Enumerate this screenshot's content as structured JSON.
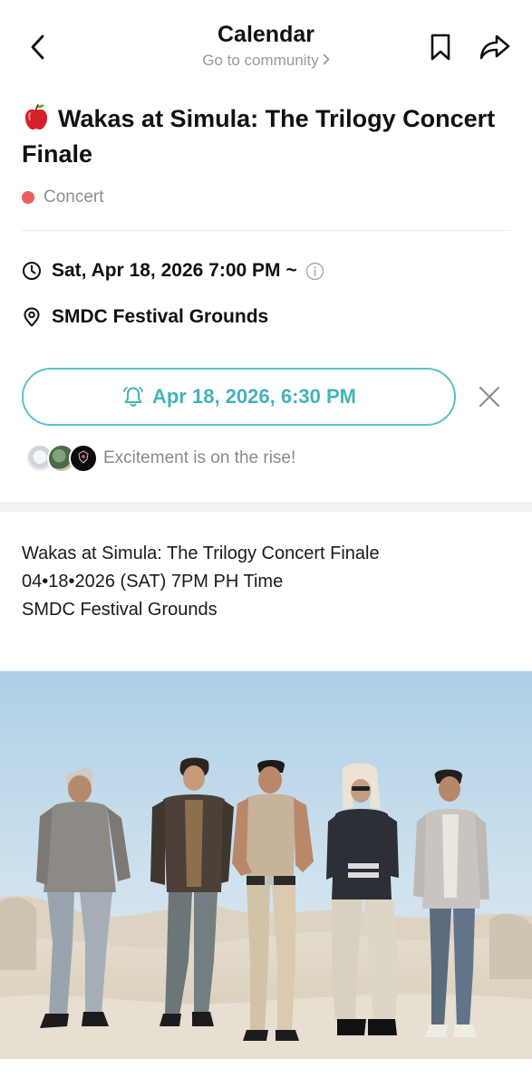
{
  "header": {
    "title": "Calendar",
    "subtitle": "Go to community",
    "icons": {
      "back": "chevron-left-icon",
      "bookmark": "bookmark-icon",
      "share": "share-arrow-icon"
    }
  },
  "event": {
    "emoji": "apple-emoji",
    "title": "Wakas at Simula: The Trilogy Concert Finale",
    "category": "Concert",
    "category_color": "#ee5d5d",
    "datetime": "Sat, Apr 18, 2026 7:00 PM ~",
    "location": "SMDC Festival Grounds"
  },
  "reminder": {
    "label": "Apr 18, 2026, 6:30 PM",
    "accent_color": "#45b2b9"
  },
  "social": {
    "message": "Excitement is on the rise!"
  },
  "description": {
    "lines": [
      "Wakas at Simula: The Trilogy Concert Finale",
      "04•18•2026 (SAT) 7PM PH Time",
      "SMDC Festival Grounds"
    ]
  }
}
